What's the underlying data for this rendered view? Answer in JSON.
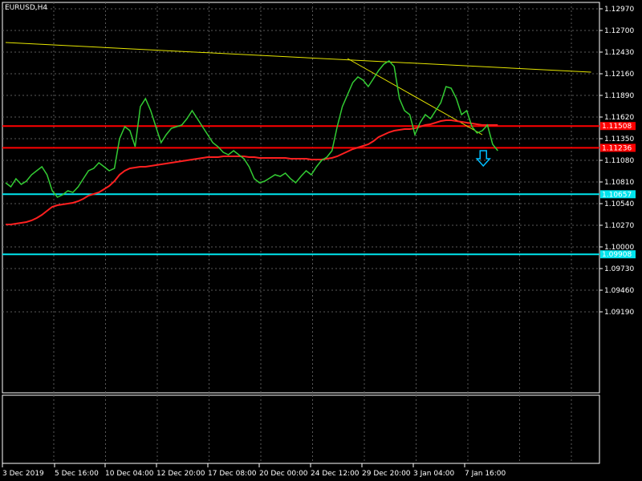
{
  "chart_data": {
    "type": "line",
    "title": "EURUSD,H4",
    "y_ticks": [
      "1.12970",
      "1.12700",
      "1.12430",
      "1.12160",
      "1.11890",
      "1.11620",
      "1.11350",
      "1.11080",
      "1.10810",
      "1.10540",
      "1.10270",
      "1.10000",
      "1.09730",
      "1.09460",
      "1.09190"
    ],
    "ylim": [
      1.089,
      1.131
    ],
    "x_ticks": [
      "3 Dec 2019",
      "5 Dec 16:00",
      "10 Dec 04:00",
      "12 Dec 20:00",
      "17 Dec 08:00",
      "20 Dec 00:00",
      "24 Dec 12:00",
      "29 Dec 20:00",
      "3 Jan 04:00",
      "7 Jan 16:00"
    ],
    "grid": true,
    "colors": {
      "background": "#000000",
      "grid": "#5a5a5a",
      "price": "#33cc33",
      "moving_average": "#ff2020",
      "resistance": "#ff0000",
      "support": "#00e5ee",
      "trendline": "#e6e600",
      "axis_text": "#ffffff",
      "arrow": "#00bfff"
    },
    "price": {
      "name": "EURUSD",
      "values": [
        1.108,
        1.1075,
        1.1085,
        1.1078,
        1.1082,
        1.109,
        1.1095,
        1.11,
        1.109,
        1.107,
        1.1062,
        1.1065,
        1.107,
        1.1068,
        1.1075,
        1.1085,
        1.1095,
        1.1098,
        1.1105,
        1.11,
        1.1095,
        1.1098,
        1.1135,
        1.115,
        1.1145,
        1.1125,
        1.1175,
        1.1185,
        1.117,
        1.115,
        1.113,
        1.114,
        1.1148,
        1.115,
        1.1152,
        1.116,
        1.117,
        1.116,
        1.115,
        1.114,
        1.113,
        1.1125,
        1.1118,
        1.1115,
        1.112,
        1.1115,
        1.111,
        1.11,
        1.1085,
        1.108,
        1.1082,
        1.1086,
        1.109,
        1.1088,
        1.1092,
        1.1085,
        1.108,
        1.1088,
        1.1095,
        1.109,
        1.11,
        1.1108,
        1.1112,
        1.112,
        1.115,
        1.1175,
        1.119,
        1.1205,
        1.1212,
        1.1208,
        1.12,
        1.121,
        1.122,
        1.1228,
        1.1232,
        1.1225,
        1.1185,
        1.117,
        1.1165,
        1.114,
        1.1155,
        1.1165,
        1.116,
        1.117,
        1.118,
        1.12,
        1.1198,
        1.1185,
        1.1165,
        1.117,
        1.115,
        1.1142,
        1.1145,
        1.1152,
        1.1128,
        1.112
      ]
    },
    "moving_average": {
      "values": [
        1.1028,
        1.1028,
        1.1029,
        1.103,
        1.1031,
        1.1033,
        1.1036,
        1.104,
        1.1045,
        1.105,
        1.1052,
        1.1053,
        1.1054,
        1.1055,
        1.1057,
        1.106,
        1.1064,
        1.1066,
        1.1068,
        1.1072,
        1.1076,
        1.1082,
        1.109,
        1.1095,
        1.1098,
        1.1099,
        1.11,
        1.11,
        1.1101,
        1.1102,
        1.1103,
        1.1104,
        1.1105,
        1.1106,
        1.1107,
        1.1108,
        1.1109,
        1.111,
        1.1111,
        1.1112,
        1.1112,
        1.1112,
        1.1113,
        1.1113,
        1.1113,
        1.1113,
        1.1113,
        1.1112,
        1.1112,
        1.1111,
        1.1111,
        1.1111,
        1.1111,
        1.1111,
        1.1111,
        1.111,
        1.111,
        1.111,
        1.111,
        1.1109,
        1.1109,
        1.1109,
        1.111,
        1.1111,
        1.1113,
        1.1116,
        1.1119,
        1.1122,
        1.1124,
        1.1126,
        1.1128,
        1.1132,
        1.1137,
        1.114,
        1.1143,
        1.1145,
        1.1146,
        1.1147,
        1.1147,
        1.1148,
        1.115,
        1.1152,
        1.1153,
        1.1155,
        1.1157,
        1.1158,
        1.1158,
        1.1157,
        1.1156,
        1.1155,
        1.1154,
        1.1153,
        1.1152,
        1.1152,
        1.1152,
        1.1152
      ]
    },
    "horizontal_lines": [
      {
        "price": "1.11508",
        "value": 1.11508,
        "color": "#ff0000",
        "label": "1.11508"
      },
      {
        "price": "1.11236",
        "value": 1.11236,
        "color": "#ff0000",
        "label": "1.11236"
      },
      {
        "price": "1.10657",
        "value": 1.10657,
        "color": "#00e5ee",
        "label": "1.10657"
      },
      {
        "price": "1.09908",
        "value": 1.09908,
        "color": "#00e5ee",
        "label": "1.09908"
      }
    ],
    "trendlines": [
      {
        "from": [
          0,
          1.1255
        ],
        "to": [
          113,
          1.1218
        ]
      },
      {
        "from": [
          66,
          1.1235
        ],
        "to": [
          92,
          1.114
        ]
      }
    ],
    "arrow": {
      "index": 86,
      "value": 1.112,
      "direction": "down",
      "icon": "down-arrow-icon"
    }
  }
}
